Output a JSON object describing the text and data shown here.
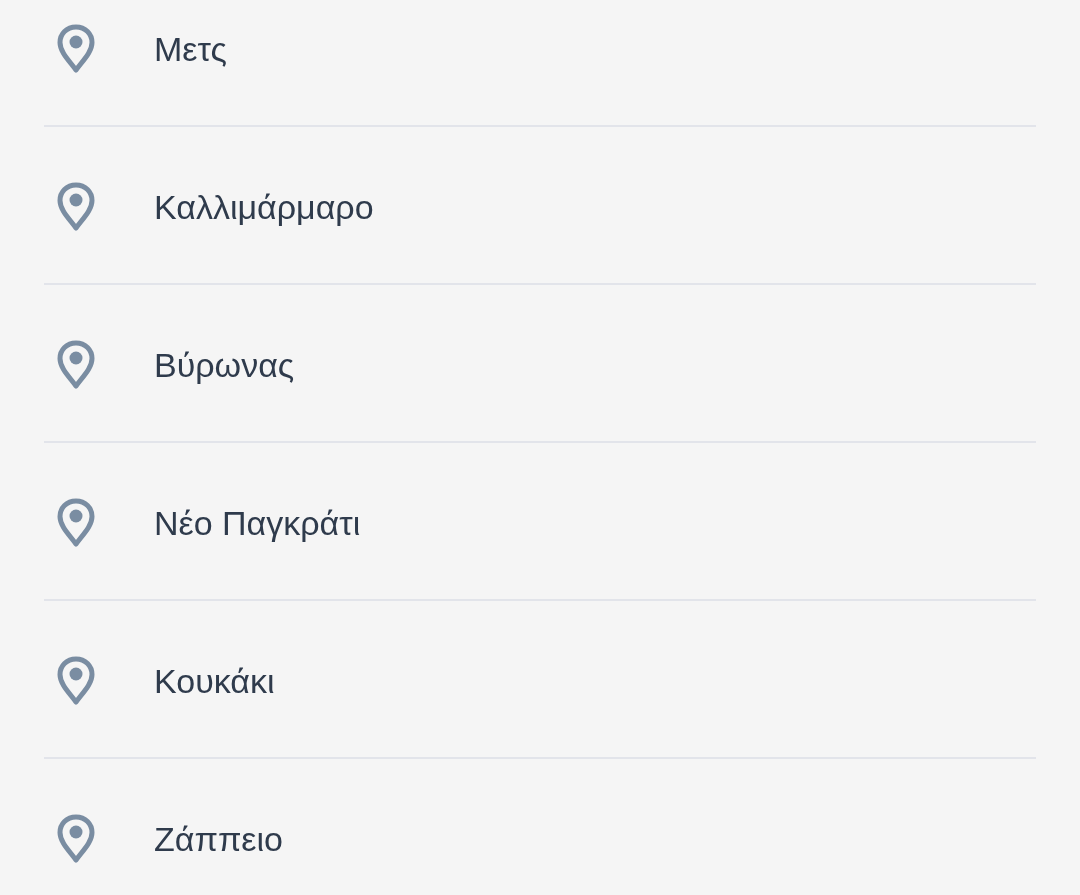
{
  "places": [
    {
      "name": "Μετς"
    },
    {
      "name": "Καλλιμάρμαρο"
    },
    {
      "name": "Βύρωνας"
    },
    {
      "name": "Νέο Παγκράτι"
    },
    {
      "name": "Κουκάκι"
    },
    {
      "name": "Ζάππειο"
    }
  ]
}
